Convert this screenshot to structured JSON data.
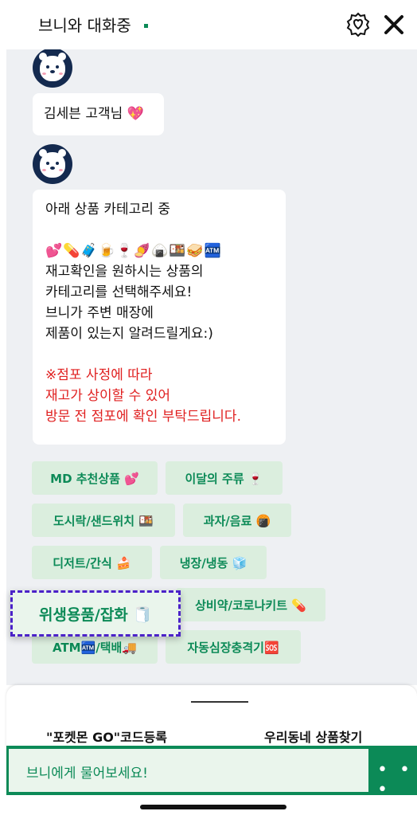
{
  "header": {
    "title": "브니와 대화중",
    "close_label": "✕"
  },
  "messages": {
    "first": "김세븐 고객님 💖",
    "second": {
      "lines_black": [
        "아래 상품 카테고리 중",
        "",
        "💕💊🧳🍺🍷🍠🍙🍱🥪🏧",
        "재고확인을 원하시는 상품의",
        "카테고리를 선택해주세요!",
        "브니가 주변 매장에",
        "제품이 있는지 알려드릴게요:)",
        ""
      ],
      "lines_red": [
        "※점포 사정에 따라",
        "재고가 상이할 수 있어",
        "방문 전 점포에 확인 부탁드립니다."
      ]
    }
  },
  "chips": [
    {
      "label": "MD 추천상품 💕"
    },
    {
      "label": "이달의 주류 🍷"
    },
    {
      "label": "도시락/샌드위치 🍱"
    },
    {
      "label": "과자/음료 🍘"
    },
    {
      "label": "디저트/간식 🍰"
    },
    {
      "label": "냉장/냉동 🧊"
    },
    {
      "label": "위생용품/잡화 🧻"
    },
    {
      "label": "상비약/코로나키트 💊"
    },
    {
      "label": "ATM🏧/택배🚚"
    },
    {
      "label": "자동심장충격기🆘"
    }
  ],
  "bottom": {
    "left_link": "\"포켓몬 GO\"코드등록",
    "right_link": "우리동네 상품찾기",
    "input_placeholder": "브니에게 물어보세요!",
    "more_label": "• • •"
  },
  "colors": {
    "brand_green": "#0c8a57",
    "chip_bg": "#dbeede",
    "highlight_border": "#4b22c8",
    "notice_red": "#e02020",
    "avatar_navy": "#142a4f"
  }
}
